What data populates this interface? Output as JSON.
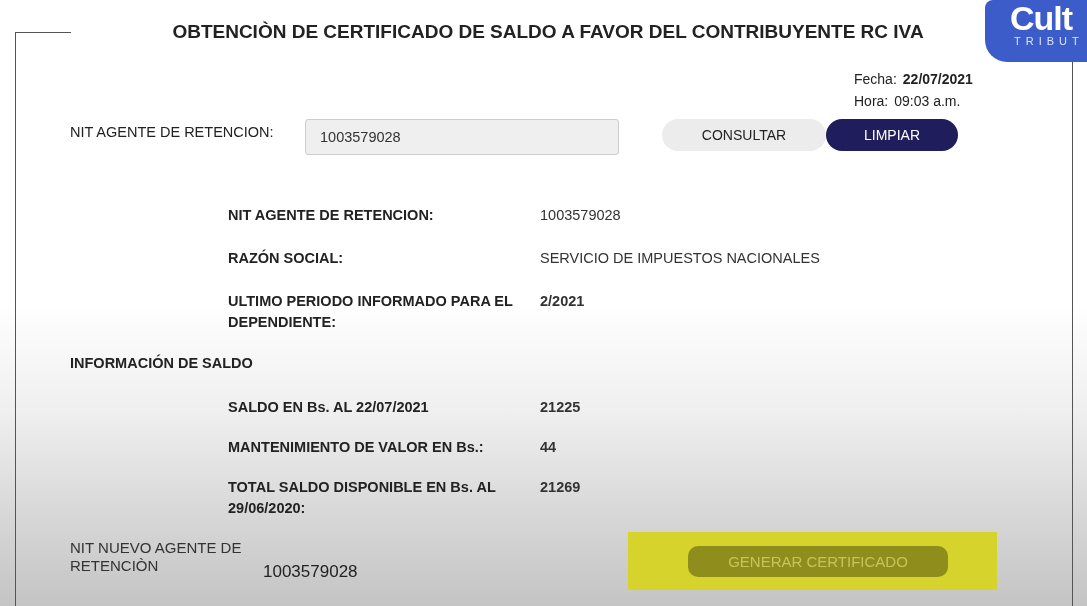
{
  "logo": {
    "text": "Cult",
    "subtitle": "TRIBUT"
  },
  "page": {
    "title": "OBTENCIÒN DE CERTIFICADO DE SALDO A FAVOR DEL CONTRIBUYENTE RC IVA"
  },
  "date": {
    "label": "Fecha:",
    "value": "22/07/2021"
  },
  "time": {
    "label": "Hora:",
    "value": "09:03 a.m."
  },
  "search": {
    "label": "NIT AGENTE DE RETENCION:",
    "value": "1003579028",
    "buttons": [
      {
        "label": "CONSULTAR",
        "kind": "secondary"
      },
      {
        "label": "LIMPIAR",
        "kind": "primary"
      }
    ]
  },
  "details": [
    {
      "label": "NIT AGENTE DE RETENCION:",
      "value": "1003579028",
      "bold": false
    },
    {
      "label": "RAZÓN SOCIAL:",
      "value": "SERVICIO DE IMPUESTOS NACIONALES",
      "bold": false
    },
    {
      "label": "ULTIMO PERIODO INFORMADO PARA EL DEPENDIENTE:",
      "value": "2/2021",
      "bold": true
    }
  ],
  "balance": {
    "heading": "INFORMACIÓN DE SALDO",
    "rows": [
      {
        "label": "SALDO EN Bs. AL 22/07/2021",
        "value": "21225",
        "bold": true
      },
      {
        "label": "MANTENIMIENTO DE VALOR EN Bs.:",
        "value": "44",
        "bold": true
      },
      {
        "label": "TOTAL SALDO DISPONIBLE EN Bs. AL 29/06/2020:",
        "value": "21269",
        "bold": true
      }
    ]
  },
  "new_agent": {
    "label": "NIT NUEVO AGENTE DE RETENCIÒN",
    "value": "1003579028"
  },
  "generate_button": {
    "label": "GENERAR CERTIFICADO",
    "highlighted": true
  }
}
